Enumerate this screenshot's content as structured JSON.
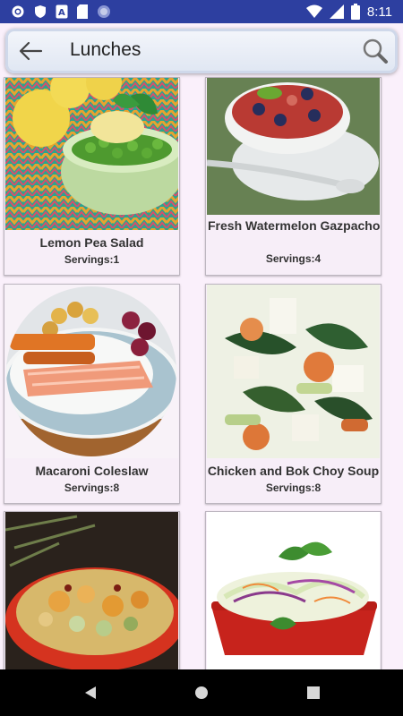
{
  "status_bar": {
    "time": "8:11"
  },
  "toolbar": {
    "title": "Lunches"
  },
  "recipes": [
    {
      "title": "Lemon Pea Salad",
      "servings": "Servings:1"
    },
    {
      "title": "Fresh Watermelon Gazpacho",
      "servings": "Servings:4"
    },
    {
      "title": "Macaroni Coleslaw",
      "servings": "Servings:8"
    },
    {
      "title": "Chicken and Bok Choy Soup",
      "servings": "Servings:8"
    },
    {
      "title": "",
      "servings": ""
    },
    {
      "title": "",
      "servings": ""
    }
  ],
  "colors": {
    "status_bar": "#2d3fa0",
    "background": "#faf0fb",
    "card": "#f7eef8"
  }
}
